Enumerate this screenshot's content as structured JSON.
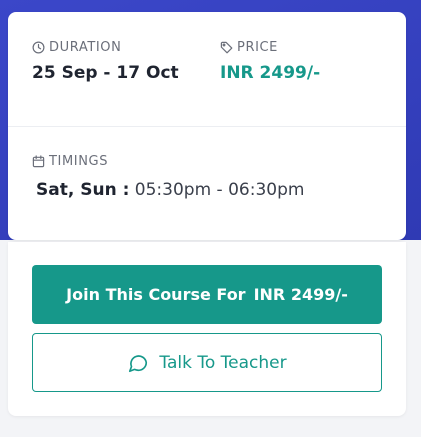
{
  "course": {
    "duration_label": "DURATION",
    "duration_value": "25 Sep - 17 Oct",
    "price_label": "PRICE",
    "price_value": "INR 2499/-",
    "timings_label": "TIMINGS",
    "timings_days": "Sat, Sun :",
    "timings_hours": "05:30pm - 06:30pm"
  },
  "actions": {
    "join_label": "Join This Course For",
    "join_price": "INR 2499/-",
    "talk_label": "Talk To Teacher"
  },
  "icons": {
    "duration": "clock-icon",
    "price": "tag-icon",
    "timings": "calendar-icon",
    "talk": "chat-bubble-icon"
  },
  "colors": {
    "accent": "#16988a",
    "header_bg": "#3b47c9",
    "text_dark": "#1f2430",
    "label_gray": "#6b6f7a"
  }
}
